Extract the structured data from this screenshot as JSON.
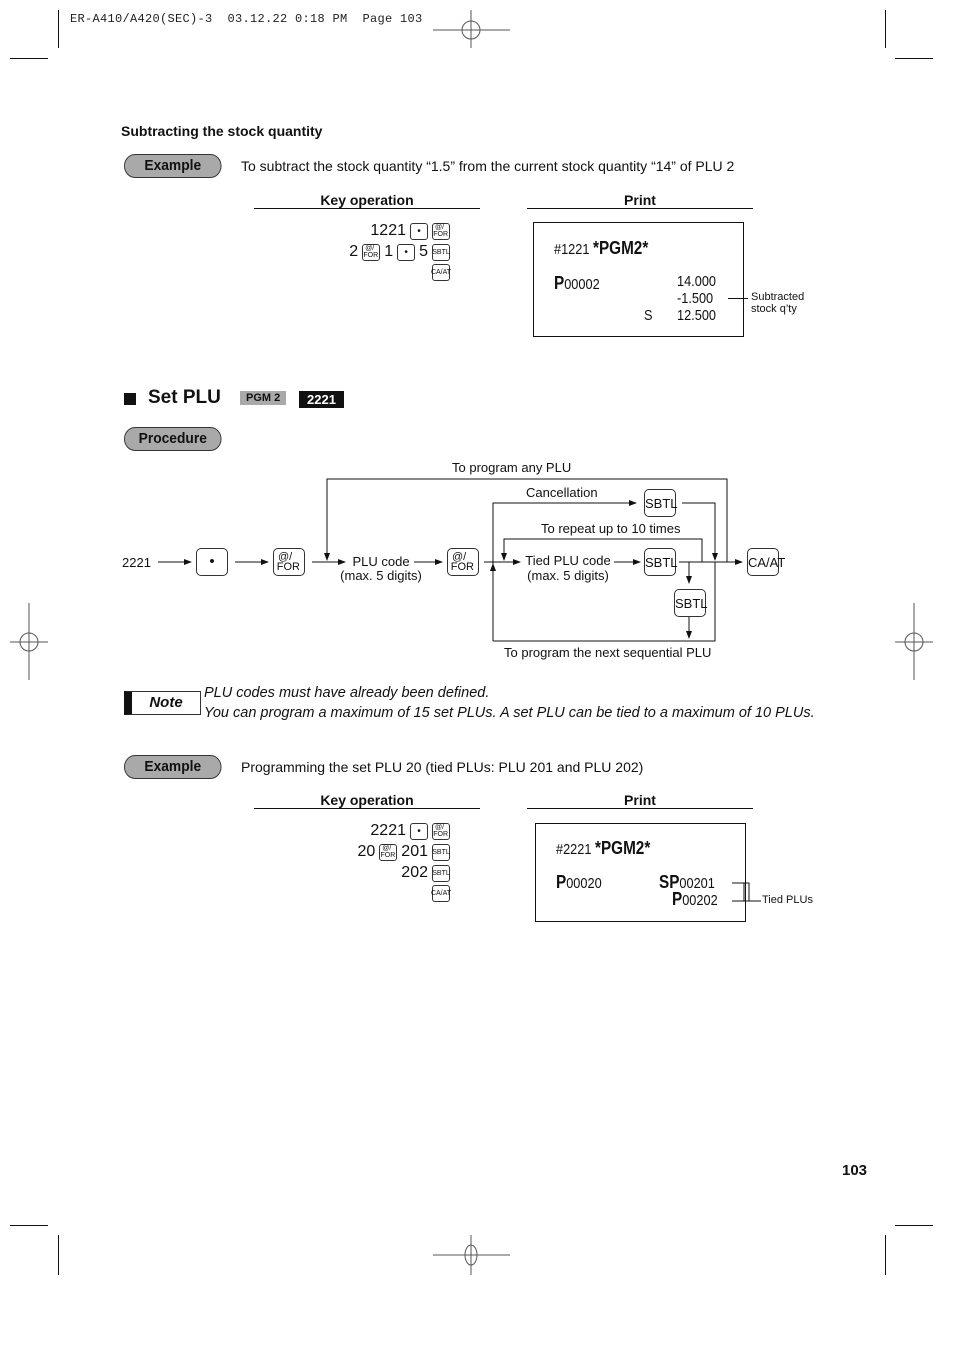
{
  "header": {
    "slug": "ER-A410/A420(SEC)-3  03.12.22 0:18 PM  Page 103"
  },
  "subtract_section": {
    "title": "Subtracting the stock quantity",
    "example_label": "Example",
    "example_text": "To subtract the stock quantity “1.5” from the current stock quantity “14” of PLU 2",
    "key_operation_heading": "Key operation",
    "print_heading": "Print",
    "key_lines": [
      {
        "number": "1221",
        "keys": [
          "dot",
          "@/FOR"
        ]
      },
      {
        "number": "2",
        "keys": [
          "@/FOR"
        ],
        "mid_number": "1",
        "keys2": [
          "dot"
        ],
        "tail_number": "5",
        "keys3": [
          "SBTL"
        ]
      },
      {
        "keys": [
          "CA/AT"
        ]
      }
    ],
    "key_labels": {
      "n1": "1221",
      "n2": "2",
      "n3": "1",
      "n4": "5",
      "dot": "•",
      "for_top": "@/",
      "for_bot": "FOR",
      "sbtl": "SBTL",
      "caat": "CA/AT"
    },
    "receipt": {
      "line1_code": "#1221",
      "line1_mode": "*PGM2*",
      "plu_prefix": "P",
      "plu_code": "00002",
      "qty_current": "14.000",
      "qty_subtracted": "-1.500",
      "total_marker": "S",
      "qty_result": "12.500"
    },
    "annotation": "Subtracted\nstock q’ty",
    "annotation_line1": "Subtracted",
    "annotation_line2": "stock q’ty"
  },
  "set_plu_section": {
    "title": "Set PLU",
    "mode_tag": "PGM 2",
    "code_tag": "2221",
    "procedure_label": "Procedure",
    "flow": {
      "start": "2221",
      "dot_key": "•",
      "for_top": "@/",
      "for_bot": "FOR",
      "plu_code_label": "PLU code",
      "plu_code_sub": "(max. 5 digits)",
      "tied_label": "Tied PLU code",
      "tied_sub": "(max. 5 digits)",
      "sbtl": "SBTL",
      "caat": "CA/AT",
      "any_plu": "To program any PLU",
      "cancellation": "Cancellation",
      "repeat": "To repeat up to 10 times",
      "next_seq": "To program the next sequential PLU"
    },
    "note_label": "Note",
    "notes": [
      "PLU codes must have already been defined.",
      "You can program a maximum of 15 set PLUs. A set PLU can be tied to a maximum of 10 PLUs."
    ],
    "example_label": "Example",
    "example_text": "Programming the set PLU 20 (tied PLUs: PLU 201 and PLU 202)",
    "key_operation_heading": "Key operation",
    "print_heading": "Print",
    "key_labels": {
      "n1": "2221",
      "n2": "20",
      "n3": "201",
      "n4": "202",
      "dot": "•",
      "for_top": "@/",
      "for_bot": "FOR",
      "sbtl": "SBTL",
      "caat": "CA/AT"
    },
    "receipt": {
      "line1_code": "#2221",
      "line1_mode": "*PGM2*",
      "plu_prefix": "P",
      "plu_code": "00020",
      "tied1_prefix": "SP",
      "tied1_code": "00201",
      "tied2_prefix": "P",
      "tied2_code": "00202"
    },
    "annotation": "Tied PLUs"
  },
  "footer": {
    "page_number": "103"
  }
}
